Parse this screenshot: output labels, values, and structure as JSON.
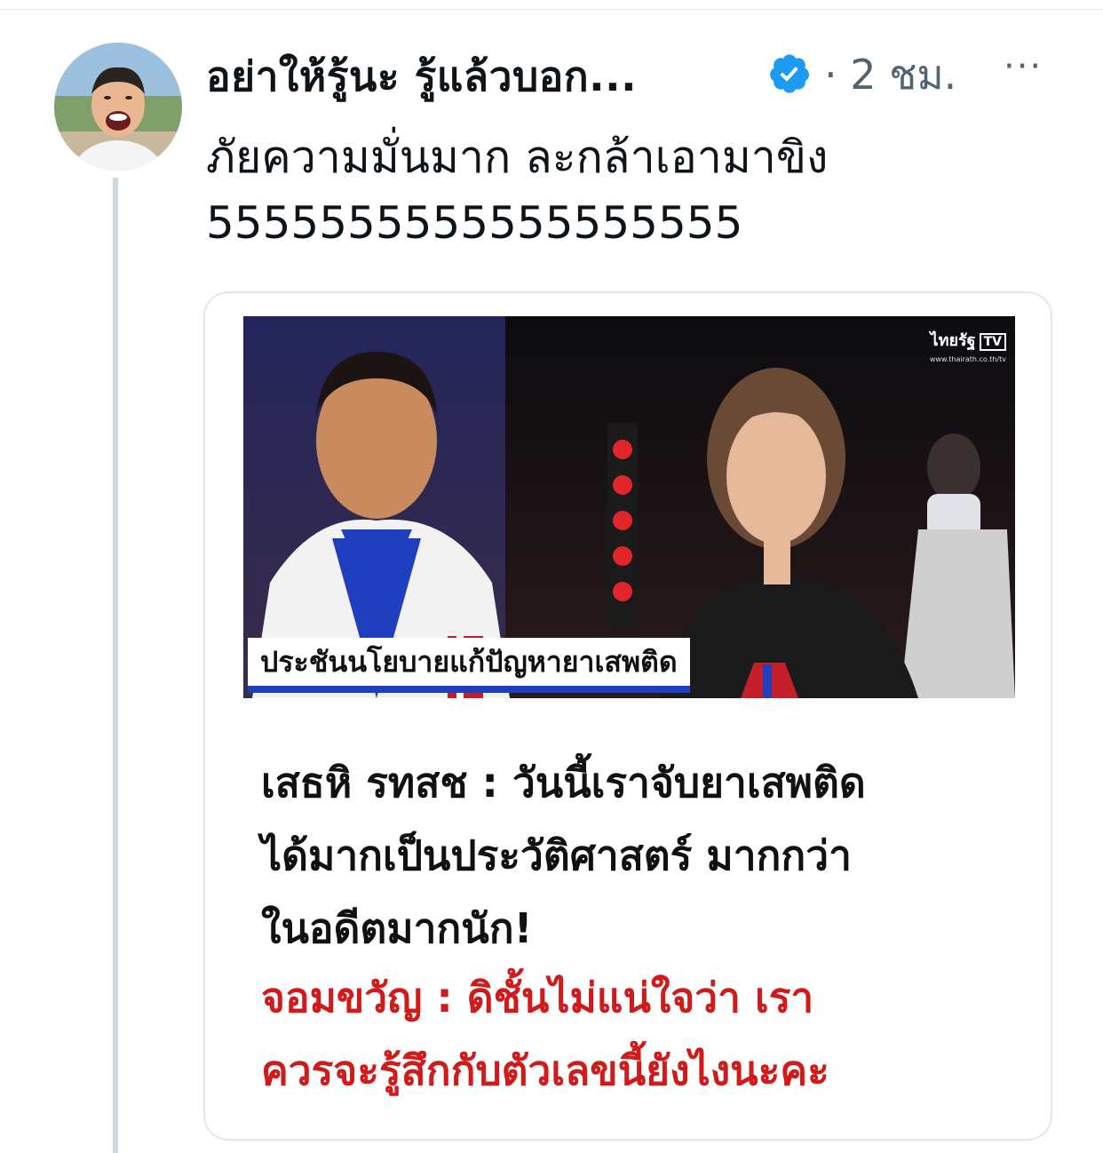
{
  "tweet": {
    "display_name": "อย่าให้รู้นะ รู้แล้วบอก...",
    "verified_icon": "verified-badge-icon",
    "timestamp": "· 2 ชม.",
    "more_label": "···",
    "text_lines": [
      "ภัยความมั่นมาก ละกล้าเอามาขิง",
      "5555555555555555555"
    ]
  },
  "card": {
    "image_caption": "ประชันนโยบายแก้ปัญหายาเสพติด",
    "channel_logo": "ไทยรัฐ",
    "channel_tv": "TV",
    "channel_url": "www.thairath.co.th/tv",
    "quote_black_lines": [
      "เสธหิ รทสช : วันนี้เราจับยาเสพติด",
      "ได้มากเป็นประวัติศาสตร์ มากกว่า",
      "ในอดีตมากนัก!"
    ],
    "quote_red_lines": [
      "จอมขวัญ : ดิชั้นไม่แน่ใจว่า เรา",
      "ควรจะรู้สึกกับตัวเลขนี้ยังไงนะคะ"
    ]
  },
  "colors": {
    "verified": "#1d9bf0",
    "muted": "#536471",
    "thread_line": "#cfd9de",
    "red_text": "#d11a1a"
  }
}
